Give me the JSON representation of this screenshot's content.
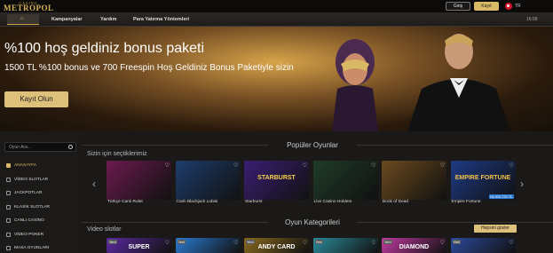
{
  "header": {
    "logo_top": "CASINO",
    "logo": "METROPOL",
    "login_label": "Giriş",
    "signup_label": "Kayıt",
    "lang": "TR",
    "clock": "16:09"
  },
  "nav": {
    "home_icon": "home-icon",
    "items": [
      "Kampanyalar",
      "Yardım",
      "Para Yatırma Yöntemleri"
    ]
  },
  "hero": {
    "title": "%100 hoş geldiniz bonus paketi",
    "subtitle": "1500 TL %100 bonus ve 700 Freespin Hoş Geldiniz Bonus Paketiyle sizin",
    "cta": "Kayıt Olun",
    "slides": 7,
    "active_slide": 3
  },
  "sidebar": {
    "search_placeholder": "Oyun Ara...",
    "items": [
      {
        "label": "ANASAYFA",
        "active": true
      },
      {
        "label": "VİDEO SLOTLAR"
      },
      {
        "label": "JACKPOTLAR"
      },
      {
        "label": "KLASİK SLOTLAR"
      },
      {
        "label": "CANLI CASİNO"
      },
      {
        "label": "VİDEO POKER"
      },
      {
        "label": "MASA OYUNLARI"
      }
    ]
  },
  "popular": {
    "title": "Popüler Oyunlar",
    "subtitle": "Sizin için seçtiklerimiz",
    "games": [
      {
        "name": "Türkçe Canlı Rulet",
        "color": "#6b1a4e"
      },
      {
        "name": "Canlı Blackjack Lobisi",
        "color": "#1e3d6b"
      },
      {
        "name": "Starburst",
        "color": "#3b1e73"
      },
      {
        "name": "Live Casino Holdem",
        "color": "#1f3b28"
      },
      {
        "name": "Book of Dead",
        "color": "#6b4a1e"
      },
      {
        "name": "Empire Fortune",
        "color": "#1e3a85",
        "badge": "15,000,720 TL"
      }
    ],
    "art": {
      "starburst": "STARBURST",
      "empire": "EMPIRE FORTUNE"
    }
  },
  "categories": {
    "title": "Oyun Kategorileri",
    "subtitle": "Video slotlar",
    "show_all": "Hepsini göster",
    "new_badge": "Yeni",
    "tiles": [
      {
        "color": "#5a2aa0",
        "text": "SUPER"
      },
      {
        "color": "#2a7ad0",
        "text": ""
      },
      {
        "color": "#8a6a20",
        "text": "ANDY CARD"
      },
      {
        "color": "#2a8a9a",
        "text": ""
      },
      {
        "color": "#c03aa0",
        "text": "DIAMOND"
      },
      {
        "color": "#2a4a9a",
        "text": ""
      }
    ]
  },
  "colors": {
    "accent": "#d9b866",
    "bg": "#141210"
  }
}
